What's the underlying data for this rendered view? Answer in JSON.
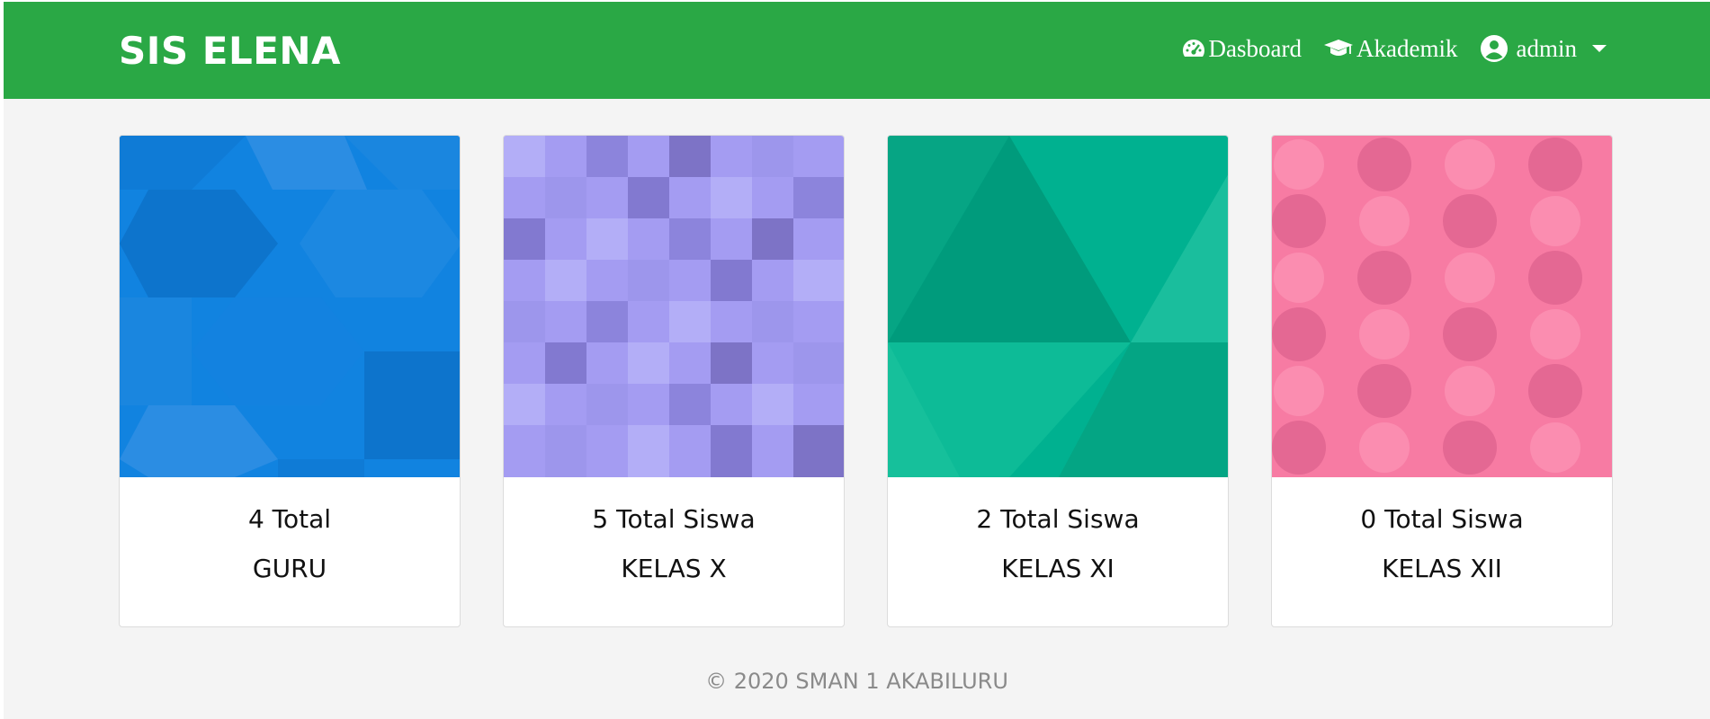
{
  "app": {
    "brand": "SIS ELENA"
  },
  "nav": {
    "items": [
      {
        "label": "Dasboard",
        "icon": "tachometer-icon"
      },
      {
        "label": "Akademik",
        "icon": "graduation-cap-icon"
      },
      {
        "label": "admin",
        "icon": "user-circle-icon"
      }
    ]
  },
  "cards": [
    {
      "title": "4 Total",
      "subtitle": "GURU",
      "pattern": "hexagons",
      "colors": [
        "#1183e0",
        "#0d74cc",
        "#2b8de3"
      ]
    },
    {
      "title": "5 Total Siswa",
      "subtitle": "KELAS X",
      "pattern": "squares",
      "colors": [
        "#a49cf2",
        "#8c84dc",
        "#b3aef7"
      ]
    },
    {
      "title": "2 Total Siswa",
      "subtitle": "KELAS XI",
      "pattern": "triangles",
      "colors": [
        "#08a887",
        "#00b190",
        "#16c09b"
      ]
    },
    {
      "title": "0 Total Siswa",
      "subtitle": "KELAS XII",
      "pattern": "octagons",
      "colors": [
        "#f77ba3",
        "#e46893",
        "#fb8db0"
      ]
    }
  ],
  "footer": {
    "text": "© 2020 SMAN 1 AKABILURU"
  },
  "colors": {
    "navbar": "#2aa845",
    "background": "#f4f4f4"
  }
}
